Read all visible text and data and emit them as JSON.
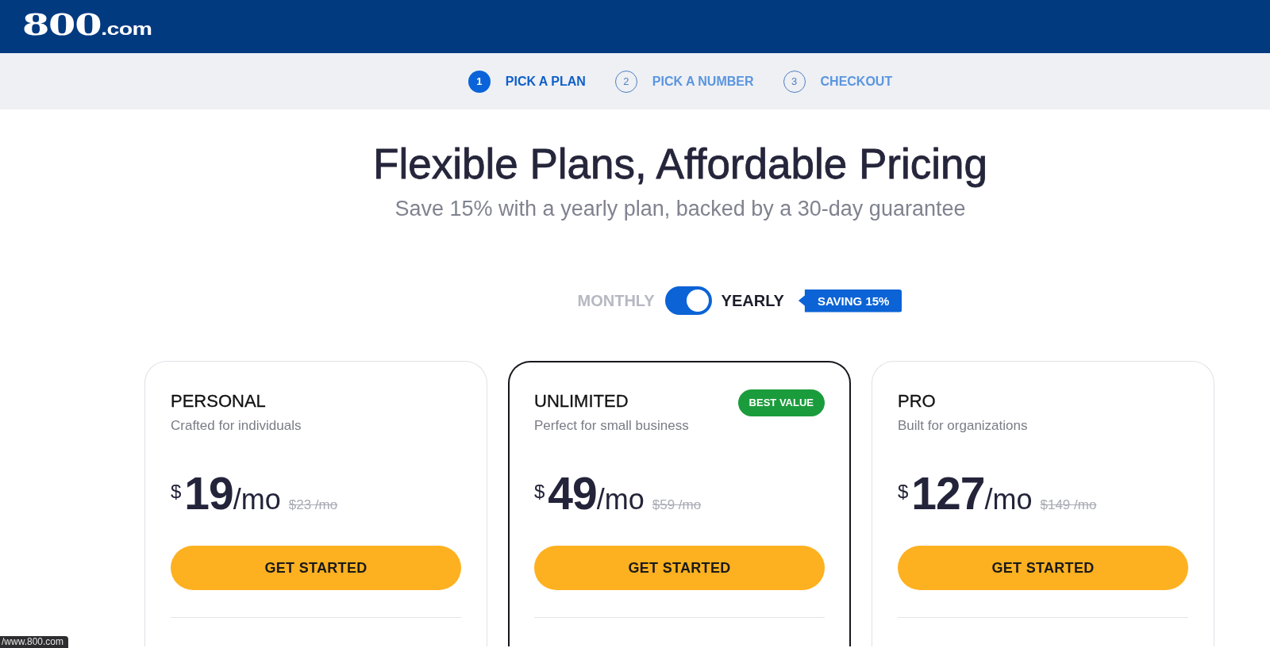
{
  "header": {
    "logo_main": "800",
    "logo_suffix": ".com"
  },
  "steps": [
    {
      "number": "1",
      "label": "PICK A PLAN",
      "selected": true
    },
    {
      "number": "2",
      "label": "PICK A NUMBER",
      "selected": false
    },
    {
      "number": "3",
      "label": "CHECKOUT",
      "selected": false
    }
  ],
  "hero": {
    "title": "Flexible Plans, Affordable Pricing",
    "subtitle": "Save 15% with a yearly plan, backed by a 30-day guarantee"
  },
  "billing": {
    "monthly_label": "MONTHLY",
    "yearly_label": "YEARLY",
    "yearly": true,
    "badge": "SAVING 15%"
  },
  "plans": [
    {
      "name": "PERSONAL",
      "tagline": "Crafted for individuals",
      "currency": "$",
      "amount": "19",
      "period": "/mo",
      "old_price": "$23 /mo",
      "button": "GET STARTED",
      "featured": false
    },
    {
      "name": "UNLIMITED",
      "badge": "BEST VALUE",
      "tagline": "Perfect for small business",
      "currency": "$",
      "amount": "49",
      "period": "/mo",
      "old_price": "$59 /mo",
      "button": "GET STARTED",
      "featured": true
    },
    {
      "name": "PRO",
      "tagline": "Built for organizations",
      "currency": "$",
      "amount": "127",
      "period": "/mo",
      "old_price": "$149 /mo",
      "button": "GET STARTED",
      "featured": false
    }
  ],
  "status_bubble": {
    "url": "/www.800.com"
  }
}
